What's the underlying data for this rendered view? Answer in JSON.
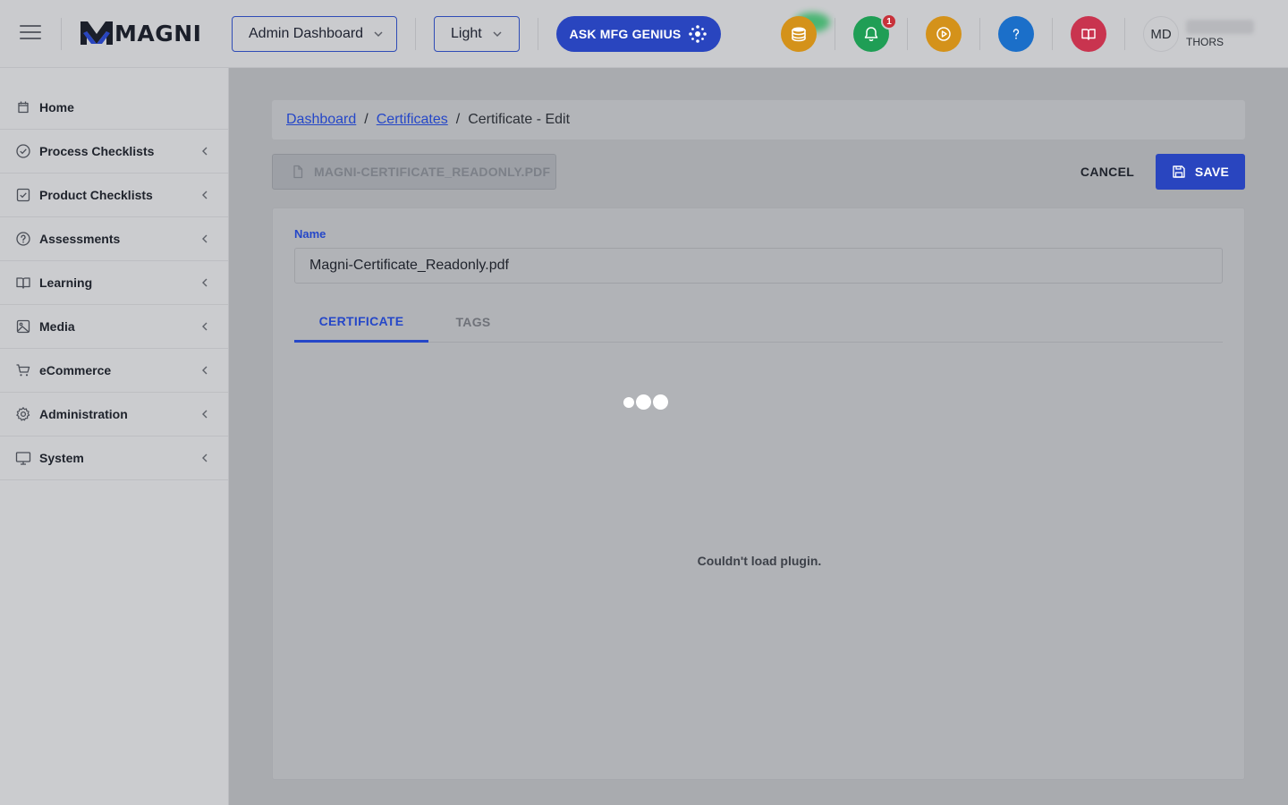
{
  "header": {
    "logo_text": "MAGNI",
    "dashboard_select": "Admin Dashboard",
    "theme_select": "Light",
    "genius_label": "ASK MFG GENIUS",
    "notification_count": "1",
    "avatar_initials": "MD",
    "user_org": "THORS"
  },
  "sidebar": {
    "items": [
      {
        "label": "Home",
        "icon": "home-icon"
      },
      {
        "label": "Process Checklists",
        "icon": "check-circle-icon"
      },
      {
        "label": "Product Checklists",
        "icon": "check-square-icon"
      },
      {
        "label": "Assessments",
        "icon": "question-circle-icon"
      },
      {
        "label": "Learning",
        "icon": "book-icon"
      },
      {
        "label": "Media",
        "icon": "image-icon"
      },
      {
        "label": "eCommerce",
        "icon": "cart-icon"
      },
      {
        "label": "Administration",
        "icon": "gear-icon"
      },
      {
        "label": "System",
        "icon": "monitor-icon"
      }
    ]
  },
  "breadcrumb": {
    "dashboard": "Dashboard",
    "certificates": "Certificates",
    "current": "Certificate - Edit",
    "separator": "/"
  },
  "toolbar": {
    "file_label": "MAGNI-CERTIFICATE_READONLY.PDF",
    "cancel_label": "CANCEL",
    "save_label": "SAVE"
  },
  "form": {
    "name_label": "Name",
    "name_value": "Magni-Certificate_Readonly.pdf"
  },
  "tabs": [
    {
      "label": "CERTIFICATE",
      "active": true
    },
    {
      "label": "TAGS",
      "active": false
    }
  ],
  "viewer": {
    "message": "Couldn't load plugin."
  },
  "colors": {
    "accent": "#2945bf",
    "notification_green": "#1f9e55",
    "badge_red": "#c8313a",
    "coin_orange": "#d4921a",
    "play_orange": "#d4921a",
    "help_blue": "#1b6fc9",
    "book_red": "#c9344f"
  }
}
